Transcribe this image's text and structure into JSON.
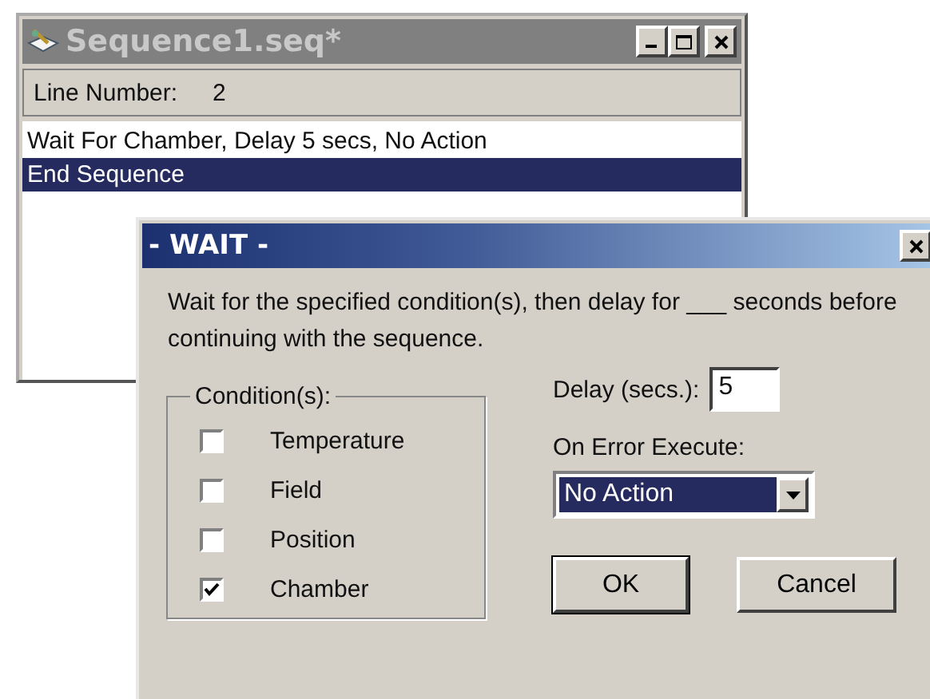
{
  "sequence_window": {
    "title": "Sequence1.seq*",
    "line_number_label": "Line Number:",
    "line_number": "2",
    "lines": [
      {
        "text": "Wait For Chamber, Delay 5 secs, No Action",
        "selected": false
      },
      {
        "text": "End Sequence",
        "selected": true
      }
    ]
  },
  "wait_dialog": {
    "title": "- WAIT -",
    "description": "Wait for the specified condition(s), then delay for ___ seconds before continuing with the sequence.",
    "conditions_label": "Condition(s):",
    "conditions": [
      {
        "label": "Temperature",
        "checked": false
      },
      {
        "label": "Field",
        "checked": false
      },
      {
        "label": "Position",
        "checked": false
      },
      {
        "label": "Chamber",
        "checked": true
      }
    ],
    "delay_label": "Delay (secs.):",
    "delay_value": "5",
    "on_error_label": "On Error Execute:",
    "on_error_value": "No Action",
    "buttons": [
      "OK",
      "Cancel"
    ]
  }
}
